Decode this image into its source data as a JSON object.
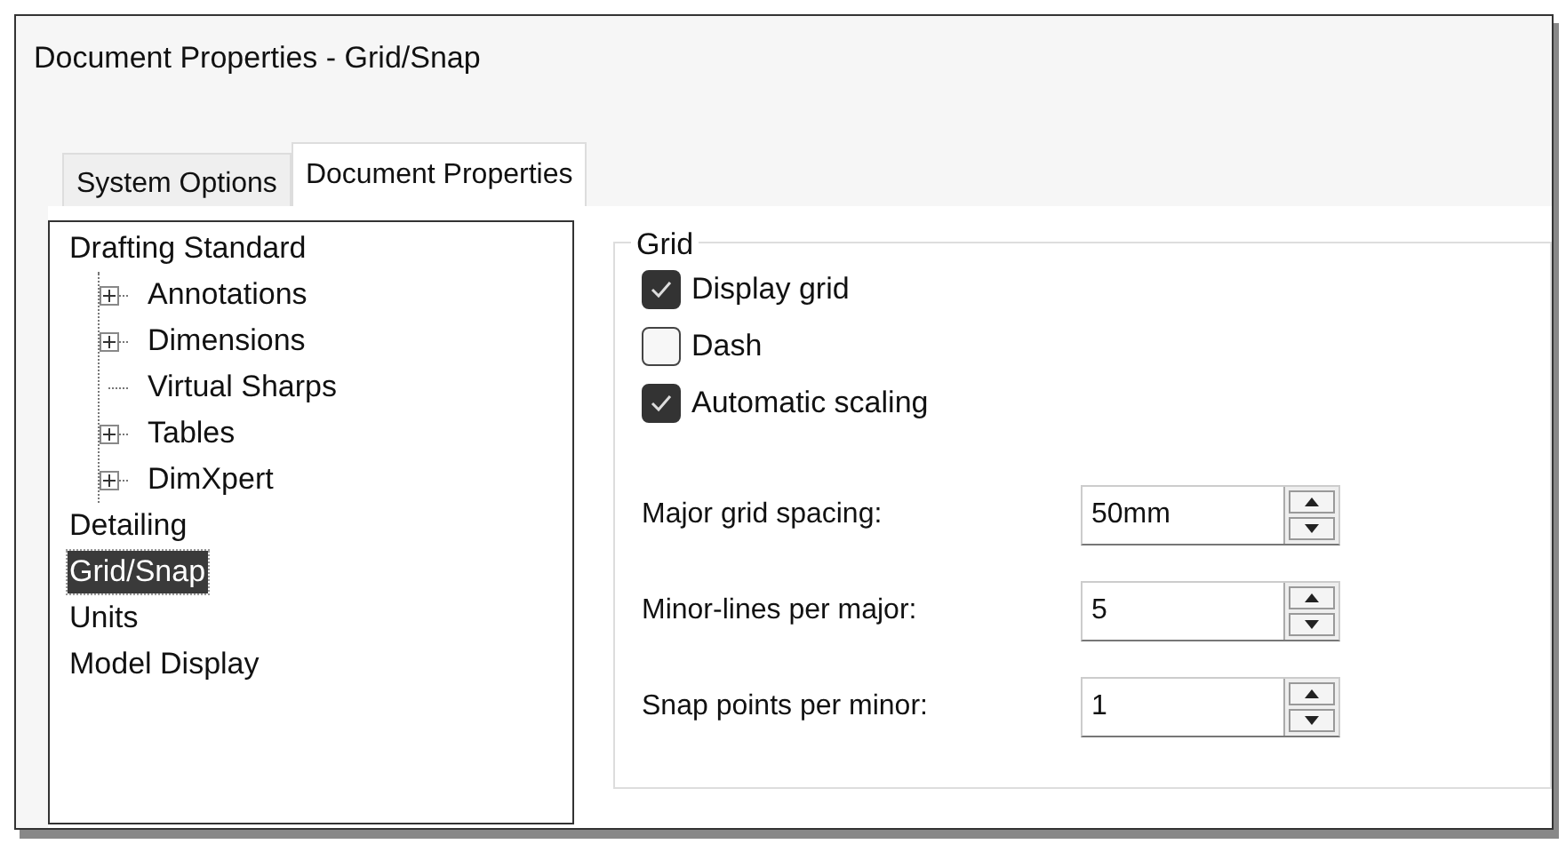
{
  "window": {
    "title": "Document Properties - Grid/Snap"
  },
  "tabs": [
    {
      "label": "System Options",
      "selected": false
    },
    {
      "label": "Document Properties",
      "selected": true
    }
  ],
  "tree": [
    {
      "label": "Drafting Standard",
      "selected": false,
      "children": [
        {
          "label": "Annotations",
          "kind": "expandable",
          "expanded": false,
          "selected": false
        },
        {
          "label": "Dimensions",
          "kind": "expandable",
          "expanded": false,
          "selected": false
        },
        {
          "label": "Virtual Sharps",
          "kind": "leaf",
          "selected": false
        },
        {
          "label": "Tables",
          "kind": "expandable",
          "expanded": false,
          "selected": false
        },
        {
          "label": "DimXpert",
          "kind": "expandable",
          "expanded": false,
          "selected": false
        }
      ]
    },
    {
      "label": "Detailing",
      "selected": false
    },
    {
      "label": "Grid/Snap",
      "selected": true
    },
    {
      "label": "Units",
      "selected": false
    },
    {
      "label": "Model Display",
      "selected": false
    }
  ],
  "grid_group": {
    "title": "Grid",
    "checkboxes": [
      {
        "label": "Display grid",
        "checked": true
      },
      {
        "label": "Dash",
        "checked": false
      },
      {
        "label": "Automatic scaling",
        "checked": true
      }
    ],
    "spinners": [
      {
        "label": "Major grid spacing:",
        "value": "50mm"
      },
      {
        "label": "Minor-lines per major:",
        "value": "5"
      },
      {
        "label": "Snap points per minor:",
        "value": "1"
      }
    ]
  }
}
